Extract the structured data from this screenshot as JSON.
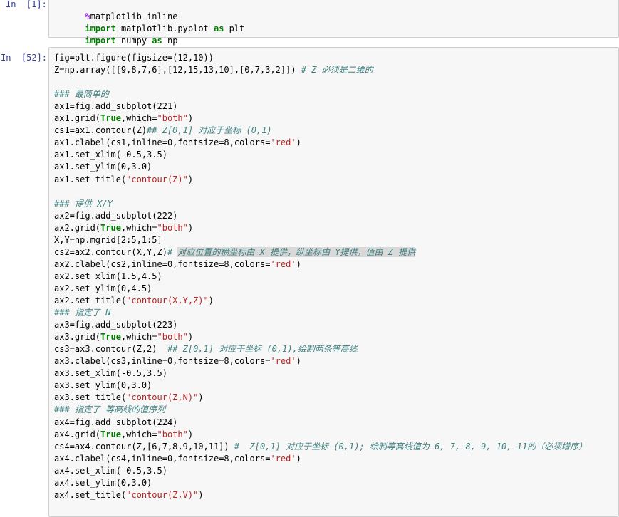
{
  "cell1": {
    "prompt": "In  [1]:",
    "lines": [
      [
        "%",
        "matplotlib inline"
      ],
      [
        "import",
        " matplotlib.pyplot ",
        "as",
        " plt"
      ],
      [
        "import",
        " numpy ",
        "as",
        " np"
      ]
    ]
  },
  "cell2": {
    "prompt": "In  [52]:",
    "lines": [
      "fig=plt.figure(figsize=(12,10))",
      "Z=np.array([[9,8,7,6],[12,15,13,10],[0,7,3,2]])",
      "",
      "### 最简单的",
      "ax1=fig.add_subplot(221)",
      "ax1.grid(True,which=\"both\")",
      "cs1=ax1.contour(Z)",
      "ax1.clabel(cs1,inline=0,fontsize=8,colors='red')",
      "ax1.set_xlim(-0.5,3.5)",
      "ax1.set_ylim(0,3.0)",
      "ax1.set_title(\"contour(Z)\")",
      "",
      "### 提供 X/Y",
      "ax2=fig.add_subplot(222)",
      "ax2.grid(True,which=\"both\")",
      "X,Y=np.mgrid[2:5,1:5]",
      "cs2=ax2.contour(X,Y,Z)",
      "ax2.clabel(cs2,inline=0,fontsize=8,colors='red')",
      "ax2.set_xlim(1.5,4.5)",
      "ax2.set_ylim(0,4.5)",
      "ax2.set_title(\"contour(X,Y,Z)\")",
      "### 指定了 N",
      "ax3=fig.add_subplot(223)",
      "ax3.grid(True,which=\"both\")",
      "cs3=ax3.contour(Z,2)",
      "ax3.clabel(cs3,inline=0,fontsize=8,colors='red')",
      "ax3.set_xlim(-0.5,3.5)",
      "ax3.set_ylim(0,3.0)",
      "ax3.set_title(\"contour(Z,N)\")",
      "### 指定了 等高线的值序列",
      "ax4=fig.add_subplot(224)",
      "ax4.grid(True,which=\"both\")",
      "cs4=ax4.contour(Z,[6,7,8,9,10,11])",
      "ax4.clabel(cs4,inline=0,fontsize=8,colors='red')",
      "ax4.set_xlim(-0.5,3.5)",
      "ax4.set_ylim(0,3.0)",
      "ax4.set_title(\"contour(Z,V)\")"
    ],
    "comments": {
      "1": " # Z 必须是二维的",
      "6": "## Z[0,1] 对应于坐标 (0,1)",
      "16": "# 对应位置的横坐标由 X 提供，纵坐标由 Y提供，值由 Z 提供",
      "24": "  ## Z[0,1] 对应于坐标 (0,1),绘制两条等高线",
      "32": " #  Z[0,1] 对应于坐标 (0,1); 绘制等高线值为 6, 7, 8, 9, 10, 11的（必须增序）"
    }
  }
}
